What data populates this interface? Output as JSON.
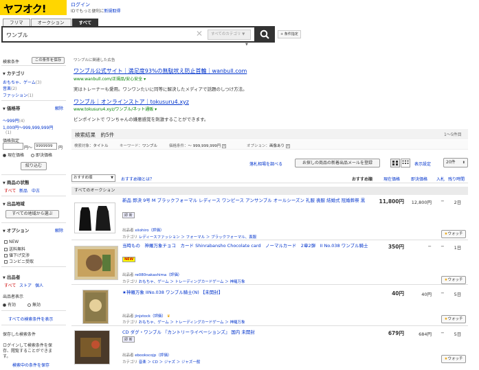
{
  "header": {
    "logo_text": "ヤフオク!",
    "login": "ログイン",
    "id_text": "IDでもっと便利に",
    "register": "新規取得"
  },
  "tabs": [
    "フリマ",
    "オークション",
    "すべて"
  ],
  "search": {
    "value": "ワンブル",
    "category": "すべてのカテゴリ",
    "cond_button": "+ 条件指定"
  },
  "sidebar": {
    "conditions": "検索条件",
    "save_button": "この条件を保存",
    "category_h": "カテゴリ",
    "categories": [
      {
        "label": "おもちゃ、ゲーム",
        "count": "(3)"
      },
      {
        "label": "音楽",
        "count": "(2)"
      },
      {
        "label": "ファッション",
        "count": "(1)"
      }
    ],
    "price_h": "価格帯",
    "clear": "解除",
    "price_ranges": [
      {
        "label": "〜999円",
        "count": "(4)"
      },
      {
        "label": "1,000円〜999,999,999円",
        "count": "(1)"
      }
    ],
    "price_spec": "価格指定",
    "yen_from": "円〜",
    "max_value": "9999999",
    "yen_to": "円",
    "current_price": "現在価格",
    "buy_now_price": "即決価格",
    "narrow_button": "絞り込む",
    "condition_h": "商品の状態",
    "cond_options": [
      "すべて",
      "新品",
      "中古"
    ],
    "region_h": "出品地域",
    "region_button": "すべての地域から選ぶ",
    "option_h": "オプション",
    "options": [
      "NEW",
      "送料無料",
      "値下げ交渉",
      "コンビニ受取"
    ],
    "seller_h": "出品者",
    "seller_options": [
      "すべて",
      "ストア",
      "個人"
    ],
    "seller_display": "出品者表示",
    "seller_radio": [
      "有効",
      "無効"
    ],
    "all_conditions_link": "すべての検索条件を表示",
    "saved_h": "保存した検索条件",
    "saved_desc": [
      "ログインして検索条件を保",
      "存、閲覧することができま",
      "す。"
    ],
    "saved_link": "検索中の条件を保存"
  },
  "ads": {
    "label": "ワンブルに関連した広告",
    "items": [
      {
        "title": "ワンブル公式サイト｜満足度93%の無駄吠え防止首輪｜wanbull.com",
        "url": "www.wanbull.com/正規品/安心安全 ▾",
        "desc": "実はトレーナーも愛用。ワンワンたいに同等に解決したメディアで話題のしつけ方法。"
      },
      {
        "title": "ワンブル｜オンラインストア｜tokusuru4.xyz",
        "url": "www.tokusuru4.xyz/ワンブル/ネット通販 ▾",
        "desc": "ピンポイントで ワンちゃんの嫌悪感覚を刺激することができます。"
      }
    ]
  },
  "results": {
    "title": "検索結果　約5件",
    "range": "1〜5件目",
    "filters": {
      "target_label": "検索対象：",
      "target": "タイトル",
      "keyword_label": "キーワード：",
      "keyword": "ワンブル",
      "price_label": "価格条件：",
      "price": "〜 999,999,999円",
      "option_label": "オプション：",
      "option": "画像あり"
    },
    "past_link": "落札相場を調べる",
    "alert_button": "お探しの商品の新着出品メールを登録",
    "display_settings": "表示設定",
    "per_page": "20件",
    "sort_select": "おすすめ順",
    "sort_help": "おすすめ順とは？",
    "columns": {
      "recommended": "おすすめ順",
      "current": "現在価格",
      "buynow": "即決価格",
      "bids": "入札",
      "left": "残り時間"
    },
    "section": "すべてのオークション",
    "watch_label": "ウォッチ"
  },
  "items": [
    {
      "title": "新品 即決 9号 M ブラックフォーマル レディース ワンピース アンサンブル オールシーズン 礼服 喪服 結婚式 冠婚葬祭 黒",
      "badge": "即 新",
      "seller_label": "出品者",
      "seller": "xiiohiro（評価）",
      "category_label": "カテゴリ",
      "category": "レディースファッション ＞ フォーマル ＞ ブラックフォーマル、喪服",
      "price": "11,800円",
      "buynow": "12,800円",
      "bids": "−",
      "left": "2日"
    },
    {
      "title": "当時もの　神羅万象チョコ　カード Shinrabansho Chocolate card　ノーマルカード　2章2弾　II No.038 ワンブル騎士",
      "badge": "NEW",
      "seller_label": "出品者",
      "seller": "re080nakashima（評価）",
      "category_label": "カテゴリ",
      "category": "おもちゃ、ゲーム ＞ トレーディングカードゲーム ＞ 神羅万象",
      "price": "350円",
      "buynow": "−",
      "bids": "−",
      "left": "1日"
    },
    {
      "title": "★神羅万象 IINo.038 ワンブル騎士(N) 【未開封】",
      "badge": "",
      "seller_label": "出品者",
      "seller": "jinjstock（評価）",
      "category_label": "カテゴリ",
      "category": "おもちゃ、ゲーム ＞ トレーディングカードゲーム ＞ 神羅万象",
      "price": "40円",
      "buynow": "40円",
      "bids": "−",
      "left": "5日"
    },
    {
      "title": "CD ダグ・ワンブル 『カントリーライベーションズ』 国内 未開封",
      "badge": "即 新",
      "seller_label": "出品者",
      "seller": "ebookscojp（評価）",
      "category_label": "カテゴリ",
      "category": "音楽 ＞ CD ＞ ジャズ ＞ ジャズ一般",
      "price": "679円",
      "buynow": "684円",
      "bids": "−",
      "left": "5日"
    }
  ],
  "colors": {
    "logo_bg": "#ffd600",
    "link": "#0033cc",
    "ad_url": "#008000"
  }
}
